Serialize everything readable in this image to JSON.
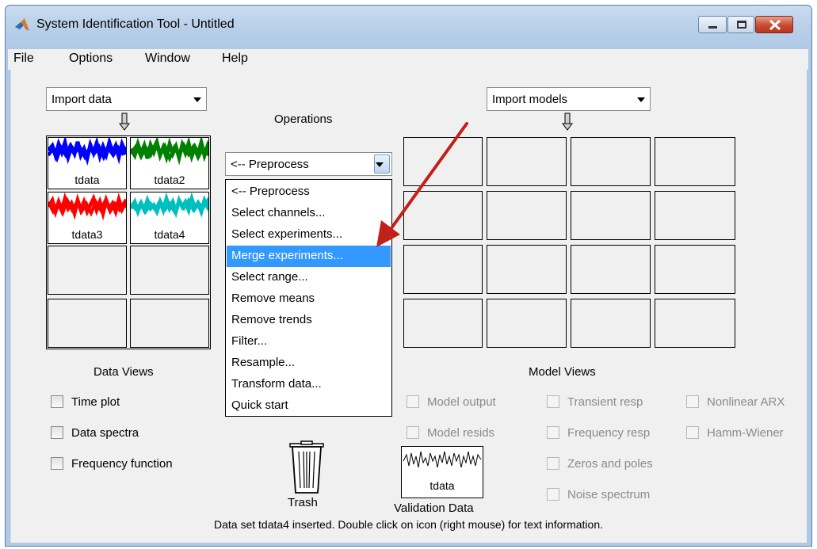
{
  "window": {
    "title": "System Identification Tool - Untitled",
    "accent": "#c84a32"
  },
  "menu": [
    "File",
    "Options",
    "Window",
    "Help"
  ],
  "data_section": {
    "import_label": "Import data",
    "icons": [
      {
        "name": "tdata",
        "color": "#0000ff"
      },
      {
        "name": "tdata2",
        "color": "#008000"
      },
      {
        "name": "tdata3",
        "color": "#ff0000"
      },
      {
        "name": "tdata4",
        "color": "#00bfbf"
      }
    ],
    "views_title": "Data Views",
    "views": [
      "Time plot",
      "Data spectra",
      "Frequency function"
    ]
  },
  "operations": {
    "title": "Operations",
    "selected": "<-- Preprocess",
    "items": [
      "<-- Preprocess",
      "Select channels...",
      "Select experiments...",
      "Merge experiments...",
      "Select range...",
      "Remove means",
      "Remove trends",
      "Filter...",
      "Resample...",
      "Transform data...",
      "Quick start"
    ],
    "highlighted_index": 3
  },
  "model_section": {
    "import_label": "Import models",
    "views_title": "Model Views",
    "views_col1": [
      "Model output",
      "Model resids"
    ],
    "views_col2": [
      "Transient resp",
      "Frequency resp",
      "Zeros and poles",
      "Noise spectrum"
    ],
    "views_col3": [
      "Nonlinear ARX",
      "Hamm-Wiener"
    ]
  },
  "trash_label": "Trash",
  "validation": {
    "label": "Validation Data",
    "data_name": "tdata"
  },
  "status": "Data set tdata4 inserted.  Double click on icon (right mouse) for text information."
}
